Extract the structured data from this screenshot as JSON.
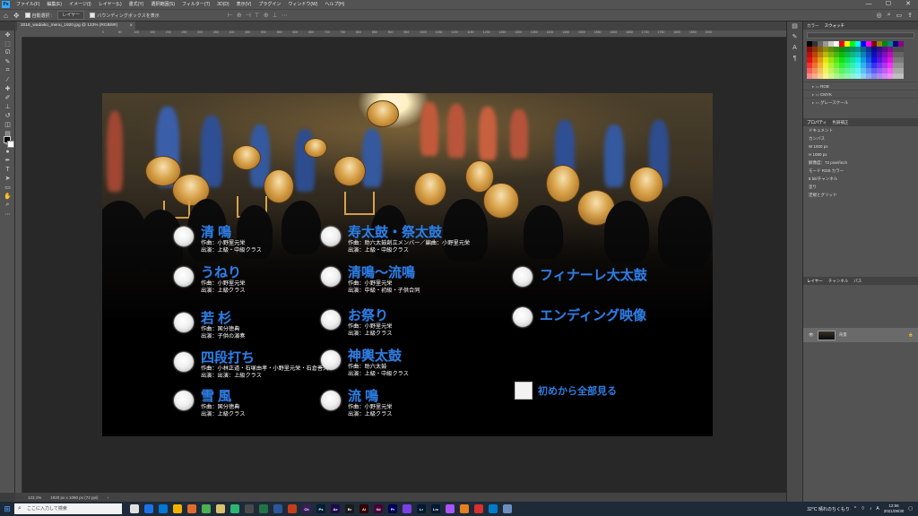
{
  "app": {
    "logo": "Ps",
    "menu": [
      "ファイル(F)",
      "編集(E)",
      "イメージ(I)",
      "レイヤー(L)",
      "書式(Y)",
      "選択範囲(S)",
      "フィルター(T)",
      "3D(D)",
      "表示(V)",
      "プラグイン",
      "ウィンドウ(W)",
      "ヘルプ(H)"
    ],
    "window_controls": [
      "—",
      "☐",
      "✕"
    ]
  },
  "options": {
    "auto_select_label": "自動選択 :",
    "auto_select_target": "レイヤー",
    "transform_label": "バウンディングボックスを表示"
  },
  "document": {
    "tab_title": "2016_wadaiko_menu_1920.jpg @ 123% (RGB/8#)",
    "zoom": "123.1%",
    "size_info": "1920 px x 1080 px (72 ppi)",
    "ruler_ticks": [
      "0",
      "50",
      "100",
      "150",
      "200",
      "250",
      "300",
      "350",
      "400",
      "450",
      "500",
      "550",
      "600",
      "650",
      "700",
      "750",
      "800",
      "850",
      "900",
      "950",
      "1000",
      "1050",
      "1100",
      "1150",
      "1200",
      "1250",
      "1300",
      "1350",
      "1400",
      "1450",
      "1500",
      "1550",
      "1600",
      "1650",
      "1700",
      "1750",
      "1800",
      "1850",
      "1900"
    ]
  },
  "menu_items": {
    "col1": [
      {
        "title": "清 鳴",
        "line1": "作曲：小野里元栄",
        "line2": "出演：上級・中級クラス"
      },
      {
        "title": "うねり",
        "line1": "作曲：小野里元栄",
        "line2": "出演：上級クラス"
      },
      {
        "title": "若 杉",
        "line1": "作曲：国分徳典",
        "line2": "出演：子供の演奏"
      },
      {
        "title": "四段打ち",
        "line1": "作曲：小林正道・石塚由孝・小野里元栄・石倉善久",
        "line2": "出演：出演：上級クラス"
      },
      {
        "title": "雪 風",
        "line1": "作曲：国分徳典",
        "line2": "出演：上級クラス"
      }
    ],
    "col2": [
      {
        "title": "寿太鼓・祭太鼓",
        "line1": "作曲：助六太鼓創立メンバー／編曲：小野里元栄",
        "line2": "出演：上級・中級クラス"
      },
      {
        "title": "清鳴〜流鳴",
        "line1": "作曲：小野里元栄",
        "line2": "出演：中級・初級・子供合同"
      },
      {
        "title": "お祭り",
        "line1": "作曲：小野里元栄",
        "line2": "出演：上級クラス"
      },
      {
        "title": "神輿太鼓",
        "line1": "作曲：助六太鼓",
        "line2": "出演：上級・中級クラス"
      },
      {
        "title": "流 鳴",
        "line1": "作曲：小野里元栄",
        "line2": "出演：上級クラス"
      }
    ],
    "col3": [
      {
        "title": "フィナーレ",
        "sub": "大太鼓"
      },
      {
        "title": "エンディング映像"
      }
    ],
    "play_all": "初めから全部見る"
  },
  "panels": {
    "swatch_tabs": [
      "カラー",
      "スウォッチ"
    ],
    "swatch_folders": [
      "RGB",
      "CMYK",
      "グレースケール"
    ],
    "properties_tabs": [
      "プロパティ",
      "色調補正"
    ],
    "properties": {
      "doc_label": "ドキュメント",
      "canvas_label": "カンバス",
      "width": "W  1920 px",
      "height": "H  1080 px",
      "resolution": "解像度：72 pixel/inch",
      "mode": "モード  RGB カラー",
      "depth": "8 bit/チャンネル",
      "fill": "塗り",
      "rulers_label": "定規とグリッド"
    },
    "layers_tabs": [
      "レイヤー",
      "チャンネル",
      "パス"
    ],
    "layer_name": "背景"
  },
  "taskbar": {
    "search_placeholder": "ここに入力して検索",
    "weather": "32°C  晴れのちくもり",
    "time": "12:56",
    "date": "2021/09/30",
    "apps": [
      {
        "label": "",
        "color": "#e0e0e0"
      },
      {
        "label": "",
        "color": "#1a73e8"
      },
      {
        "label": "",
        "color": "#0078d4"
      },
      {
        "label": "",
        "color": "#f0b400"
      },
      {
        "label": "",
        "color": "#e06c2e"
      },
      {
        "label": "",
        "color": "#4caf50"
      },
      {
        "label": "",
        "color": "#d9c26e"
      },
      {
        "label": "",
        "color": "#2bb673"
      },
      {
        "label": "",
        "color": "#4a4a4a"
      },
      {
        "label": "",
        "color": "#217346"
      },
      {
        "label": "",
        "color": "#2b579a"
      },
      {
        "label": "",
        "color": "#c43e1c"
      },
      {
        "label": "Ch",
        "color": "#3a1c5a"
      },
      {
        "label": "Ps",
        "color": "#001e36"
      },
      {
        "label": "Ae",
        "color": "#1f0a4a"
      },
      {
        "label": "Br",
        "color": "#1a1a1a"
      },
      {
        "label": "Ai",
        "color": "#330000"
      },
      {
        "label": "Xd",
        "color": "#470137"
      },
      {
        "label": "Pr",
        "color": "#00005b"
      },
      {
        "label": "",
        "color": "#7b3fe4"
      },
      {
        "label": "Lr",
        "color": "#001a33"
      },
      {
        "label": "Lrc",
        "color": "#001a33"
      },
      {
        "label": "",
        "color": "#a855f7"
      },
      {
        "label": "",
        "color": "#e67e22"
      },
      {
        "label": "",
        "color": "#d63031"
      },
      {
        "label": "",
        "color": "#007acc"
      },
      {
        "label": "",
        "color": "#6c8ebf"
      }
    ]
  },
  "colors": {
    "accent_blue": "#2f7de1",
    "ps_blue": "#31a8ff"
  }
}
